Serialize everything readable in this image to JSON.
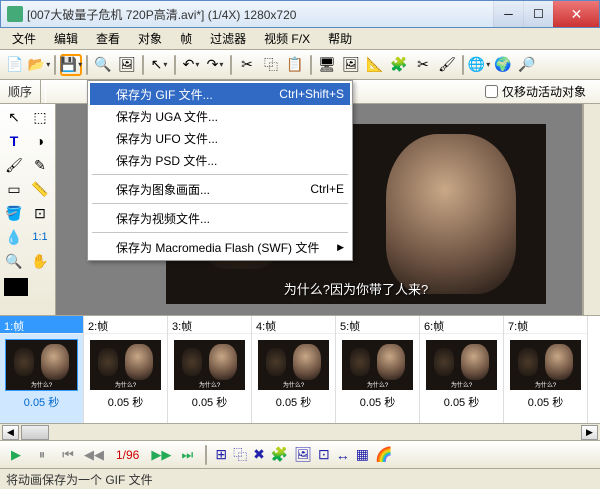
{
  "window": {
    "title": "[007大破量子危机 720P高清.avi*] (1/4X)   1280x720"
  },
  "menu": {
    "items": [
      "文件",
      "编辑",
      "查看",
      "对象",
      "帧",
      "过滤器",
      "视频 F/X",
      "帮助"
    ]
  },
  "row2": {
    "sequence_label": "顺序",
    "checkbox_label": "仅移动活动对象"
  },
  "dropdown": {
    "items": [
      {
        "label": "保存为 GIF 文件...",
        "shortcut": "Ctrl+Shift+S",
        "selected": true
      },
      {
        "label": "保存为 UGA 文件..."
      },
      {
        "label": "保存为 UFO 文件..."
      },
      {
        "label": "保存为 PSD 文件..."
      },
      {
        "sep": true
      },
      {
        "label": "保存为图象画面...",
        "shortcut": "Ctrl+E"
      },
      {
        "sep": true
      },
      {
        "label": "保存为视频文件..."
      },
      {
        "sep": true
      },
      {
        "label": "保存为 Macromedia Flash (SWF) 文件",
        "submenu": true
      }
    ]
  },
  "video": {
    "subtitle": "为什么?因为你带了人来?"
  },
  "frames": [
    {
      "hdr": "1:帧",
      "dur": "0.05 秒",
      "sel": true
    },
    {
      "hdr": "2:帧",
      "dur": "0.05 秒"
    },
    {
      "hdr": "3:帧",
      "dur": "0.05 秒"
    },
    {
      "hdr": "4:帧",
      "dur": "0.05 秒"
    },
    {
      "hdr": "5:帧",
      "dur": "0.05 秒"
    },
    {
      "hdr": "6:帧",
      "dur": "0.05 秒"
    },
    {
      "hdr": "7:帧",
      "dur": "0.05 秒"
    }
  ],
  "playbar": {
    "counter": "1/96"
  },
  "status": {
    "text": "将动画保存为一个 GIF 文件"
  },
  "colors": {
    "selection": "#316ac5",
    "highlight": "#3399ff",
    "accent_border": "#f90"
  }
}
